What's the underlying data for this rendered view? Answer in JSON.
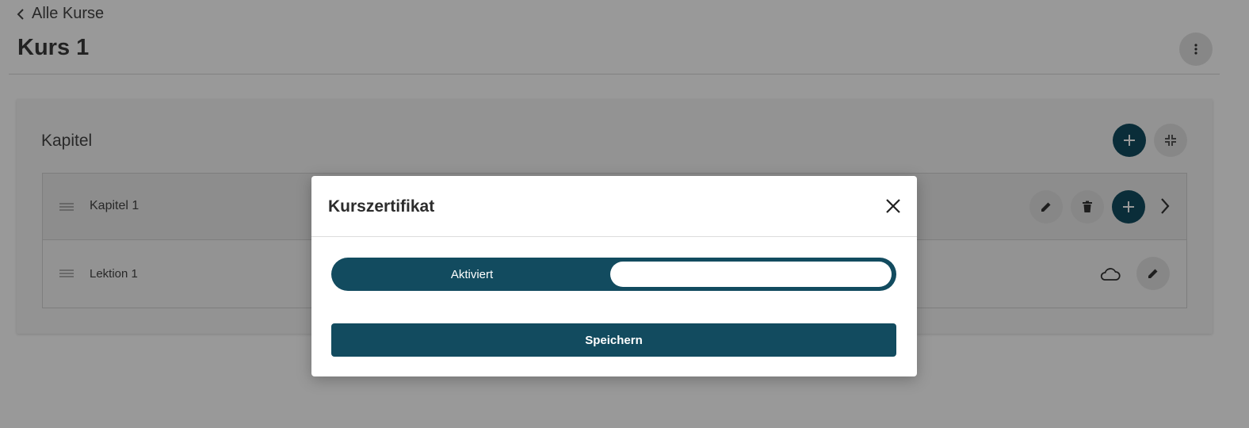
{
  "header": {
    "back_label": "Alle Kurse",
    "title": "Kurs 1",
    "more_icon": "more-vert-icon"
  },
  "chapters": {
    "title": "Kapitel",
    "add_icon": "plus-icon",
    "collapse_icon": "collapse-icon",
    "items": [
      {
        "label": "Kapitel 1",
        "icons": [
          "edit-icon",
          "delete-icon",
          "plus-icon",
          "chevron-right-icon"
        ]
      },
      {
        "label": "Lektion 1",
        "icons": [
          "cloud-icon",
          "edit-icon"
        ]
      }
    ]
  },
  "modal": {
    "title": "Kurszertifikat",
    "toggle_on_label": "Aktiviert",
    "toggle_state": "on",
    "save_label": "Speichern"
  },
  "colors": {
    "primary": "#124b5f",
    "button_grey": "#e2e2e2",
    "overlay": "rgba(0,0,0,0.4)"
  }
}
